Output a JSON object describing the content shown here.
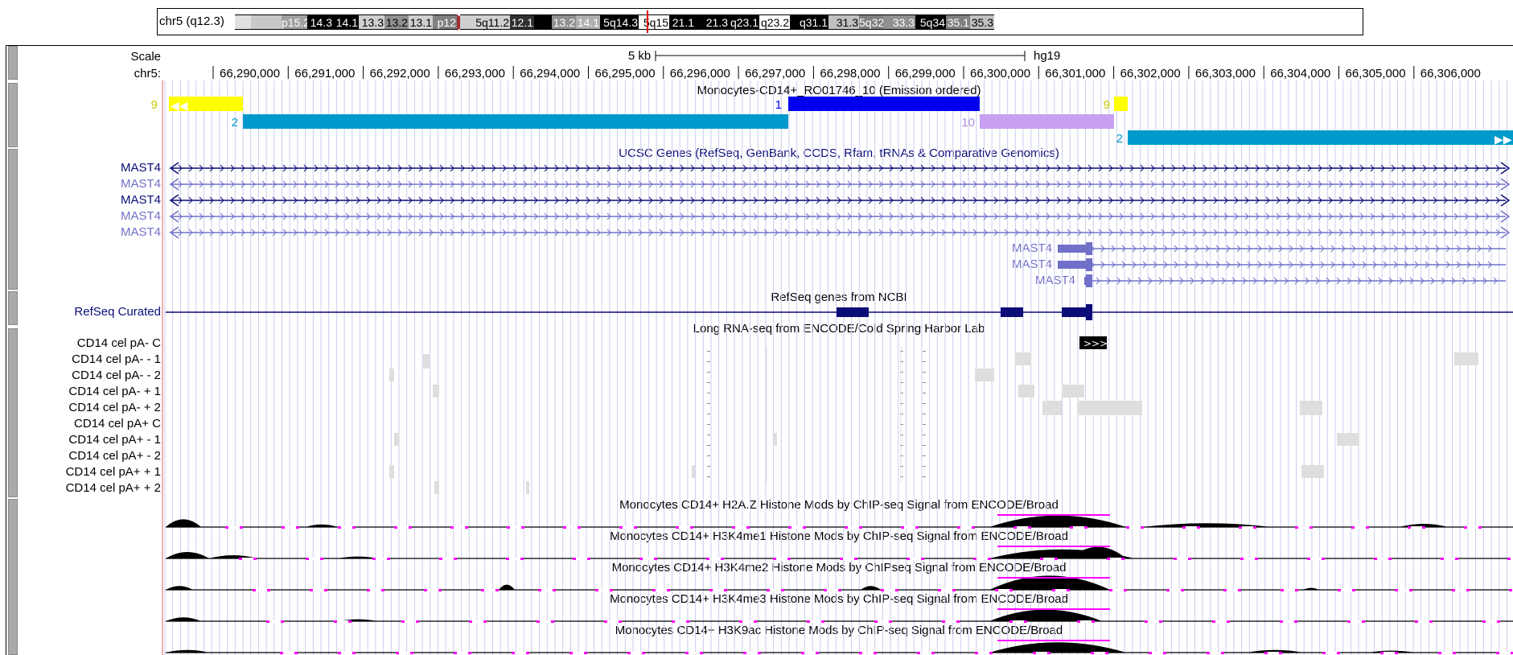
{
  "ideogram": {
    "label": "chr5 (q12.3)",
    "bands": [
      {
        "label": "",
        "color": "#e0e0e0"
      },
      {
        "label": "",
        "color": "#c8c8c8"
      },
      {
        "label": "p15.2",
        "color": "#a0a0a0",
        "text": "#ffffff"
      },
      {
        "label": "14.3",
        "color": "#000000",
        "text": "#ffffff"
      },
      {
        "label": "14.1",
        "color": "#000000",
        "text": "#ffffff"
      },
      {
        "label": "13.3",
        "color": "#d0d0d0"
      },
      {
        "label": "13.2",
        "color": "#909090"
      },
      {
        "label": "13.1",
        "color": "#d0d0d0"
      },
      {
        "label": "p12",
        "color": "#808080",
        "text": "#ffffff"
      },
      {
        "label": "5q11.2",
        "color": "#d0d0d0"
      },
      {
        "label": "12.1",
        "color": "#303030",
        "text": "#ffffff"
      },
      {
        "label": "",
        "color": "#000000"
      },
      {
        "label": "13.2",
        "color": "#909090",
        "text": "#ffffff"
      },
      {
        "label": "14.1",
        "color": "#b0b0b0",
        "text": "#ffffff"
      },
      {
        "label": "5q14.3",
        "color": "#000000",
        "text": "#ffffff"
      },
      {
        "label": "5q15",
        "color": "#ffffff"
      },
      {
        "label": "21.1",
        "color": "#000000",
        "text": "#ffffff"
      },
      {
        "label": "21.3",
        "color": "#000000",
        "text": "#ffffff"
      },
      {
        "label": "q23.1",
        "color": "#000000",
        "text": "#ffffff"
      },
      {
        "label": "q23.2",
        "color": "#ffffff"
      },
      {
        "label": "q31.1",
        "color": "#000000",
        "text": "#ffffff"
      },
      {
        "label": "31.3",
        "color": "#c0c0c0"
      },
      {
        "label": "5q32",
        "color": "#808080",
        "text": "#ffffff"
      },
      {
        "label": "33.3",
        "color": "#909090",
        "text": "#ffffff"
      },
      {
        "label": "5q34",
        "color": "#000000",
        "text": "#ffffff"
      },
      {
        "label": "35.1",
        "color": "#808080",
        "text": "#ffffff"
      },
      {
        "label": "35.3",
        "color": "#c0c0c0"
      }
    ]
  },
  "ruler": {
    "scale_label": "Scale",
    "chrom_label": "chr5:",
    "scale_bar_text": "5 kb",
    "assembly": "hg19",
    "ticks": [
      "66,290,000",
      "66,291,000",
      "66,292,000",
      "66,293,000",
      "66,294,000",
      "66,295,000",
      "66,296,000",
      "66,297,000",
      "66,298,000",
      "66,299,000",
      "66,300,000",
      "66,301,000",
      "66,302,000",
      "66,303,000",
      "66,304,000",
      "66,305,000",
      "66,306,000"
    ]
  },
  "chromhmm": {
    "title": "Monocytes-CD14+_RO01746_10 (Emission ordered)",
    "segments": [
      {
        "label": "9",
        "color": "#ffff00"
      },
      {
        "label": "2",
        "color": "#0099cc"
      },
      {
        "label": "1",
        "color": "#0000ee"
      },
      {
        "label": "10",
        "color": "#c8a0f0"
      },
      {
        "label": "9",
        "color": "#ffff00"
      },
      {
        "label": "2",
        "color": "#0099cc"
      }
    ]
  },
  "ucsc_genes": {
    "title": "UCSC Genes (RefSeq, GenBank, CCDS, Rfam, tRNAs & Comparative Genomics)",
    "genes": [
      "MAST4",
      "MAST4",
      "MAST4",
      "MAST4",
      "MAST4",
      "MAST4",
      "MAST4",
      "MAST4"
    ],
    "colors": {
      "dark": "#0c0c78",
      "light": "#7070c8"
    }
  },
  "refseq": {
    "label": "RefSeq Curated",
    "title": "RefSeq genes from NCBI",
    "color": "#0c0c78"
  },
  "rnaseq": {
    "title": "Long RNA-seq from ENCODE/Cold Spring Harbor Lab",
    "tracks": [
      "CD14 cel pA- C",
      "CD14 cel pA- - 1",
      "CD14 cel pA- - 2",
      "CD14 cel pA- + 1",
      "CD14 cel pA- + 2",
      "CD14 cel pA+ C",
      "CD14 cel pA+ - 1",
      "CD14 cel pA+ - 2",
      "CD14 cel pA+ + 1",
      "CD14 cel pA+ + 2"
    ],
    "contig_arrows": ">>>"
  },
  "histone": {
    "tracks": [
      "Monocytes CD14+ H2A.Z Histone Mods by ChIP-seq Signal from ENCODE/Broad",
      "Monocytes CD14+ H3K4me1 Histone Mods by ChIP-seq Signal from ENCODE/Broad",
      "Monocytes CD14+ H3K4me2 Histone Mods by ChIPseq Signal from ENCODE/Broad",
      "Monocytes CD14+ H3K4me3 Histone Mods by ChIP-seq Signal from ENCODE/Broad",
      "Monocytes CD14+ H3K9ac Histone Mods by ChIP-seq Signal from ENCODE/Broad"
    ],
    "gap_color": "#ff00ff"
  },
  "colors": {
    "grid": "#ccccee",
    "chromhmm_label_9": "#c8c800",
    "chromhmm_label_2": "#0099cc",
    "chromhmm_label_1": "#0000ee",
    "chromhmm_label_10": "#b090e0"
  }
}
